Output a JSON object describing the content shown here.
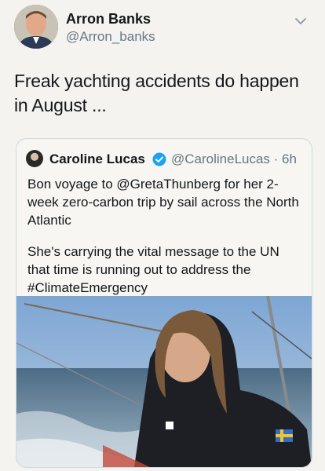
{
  "tweet": {
    "author_name": "Arron Banks",
    "author_handle": "@Arron_banks",
    "text": "Freak yachting accidents do happen in August ...",
    "icons": {
      "avatar": "profile-photo",
      "menu": "chevron-down-icon"
    }
  },
  "quoted_tweet": {
    "author_name": "Caroline Lucas",
    "author_handle": "@CarolineLucas",
    "time": "· 6h",
    "paragraph_1": "Bon voyage to @GretaThunberg for her 2-week zero-carbon trip by sail across the North Atlantic",
    "paragraph_2": "She's carrying the vital message to the UN that time is running out to address the #ClimateEmergency",
    "icons": {
      "verified": "verified-badge-icon"
    },
    "colors": {
      "verified": "#1da1f2"
    }
  }
}
